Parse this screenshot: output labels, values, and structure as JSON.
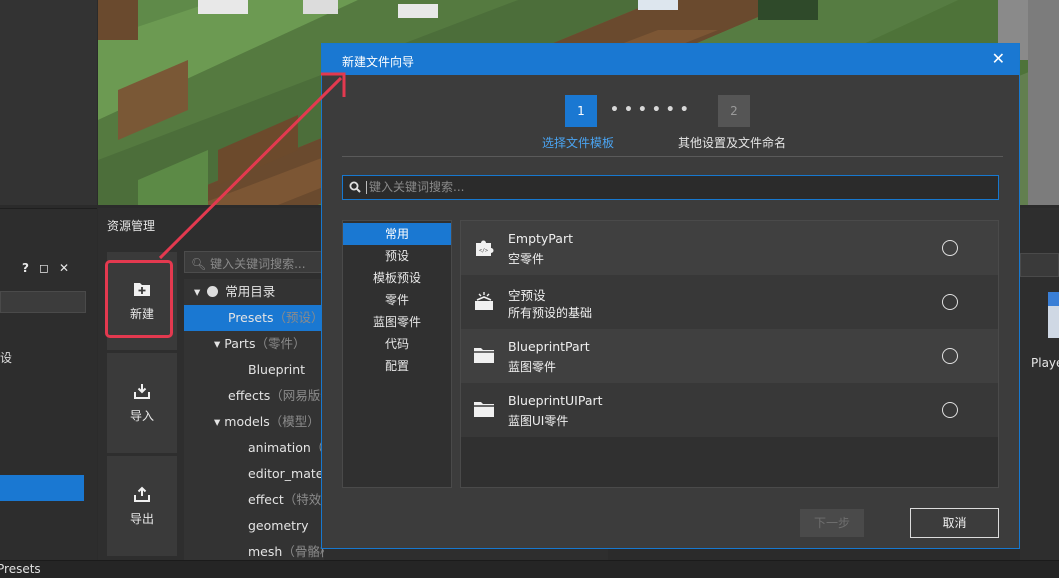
{
  "left_panel": {
    "icons": [
      "?",
      "◻",
      "✕"
    ],
    "partial_text": "设"
  },
  "assets": {
    "title": "资源管理",
    "new_label": "新建",
    "import_label": "导入",
    "export_label": "导出",
    "search_placeholder": "键入关键词搜索...",
    "tree": [
      {
        "label": "常用目录",
        "sub": ""
      },
      {
        "label": "Presets",
        "sub": "（预设）"
      },
      {
        "label": "Parts",
        "sub": "（零件）"
      },
      {
        "label": "Blueprint",
        "sub": ""
      },
      {
        "label": "effects",
        "sub": "（网易版特"
      },
      {
        "label": "models",
        "sub": "（模型）"
      },
      {
        "label": "animation",
        "sub": "（"
      },
      {
        "label": "editor_mater",
        "sub": ""
      },
      {
        "label": "effect",
        "sub": "（特效扎"
      },
      {
        "label": "geometry",
        "sub": ""
      },
      {
        "label": "mesh",
        "sub": "（骨骼模型网格）"
      }
    ]
  },
  "right": {
    "player_label": "Playe"
  },
  "status_bar": {
    "text": "Presets"
  },
  "dialog": {
    "title": "新建文件向导",
    "close": "✕",
    "steps": [
      {
        "number": "1",
        "label": "选择文件模板"
      },
      {
        "number": "2",
        "label": "其他设置及文件命名"
      }
    ],
    "step_dots": "••••••",
    "search_placeholder": "键入关键词搜索...",
    "categories": [
      "常用",
      "预设",
      "模板预设",
      "零件",
      "蓝图零件",
      "代码",
      "配置"
    ],
    "templates": [
      {
        "name": "EmptyPart",
        "desc": "空零件",
        "icon": "puzzle-icon"
      },
      {
        "name": "空预设",
        "desc": "所有预设的基础",
        "icon": "preset-box-icon"
      },
      {
        "name": "BlueprintPart",
        "desc": "蓝图零件",
        "icon": "folder-icon"
      },
      {
        "name": "BlueprintUIPart",
        "desc": "蓝图UI零件",
        "icon": "folder-icon"
      }
    ],
    "next_label": "下一步",
    "cancel_label": "取消"
  },
  "colors": {
    "accent": "#1a78d2",
    "highlight": "#e3394f"
  }
}
